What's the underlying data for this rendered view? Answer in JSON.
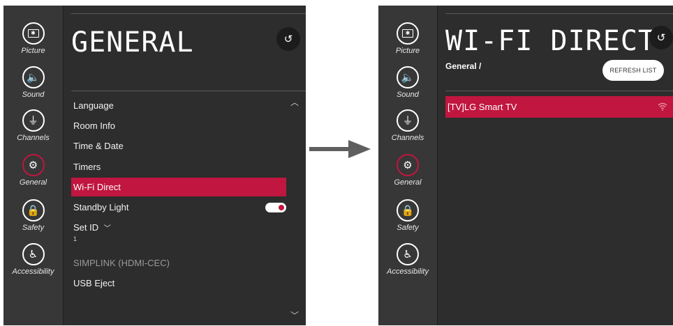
{
  "left_screen": {
    "title": "GENERAL",
    "back_icon": "back-arrow-icon",
    "categories": [
      {
        "label": "Picture",
        "icon": "tv-picture-icon"
      },
      {
        "label": "Sound",
        "icon": "speaker-icon"
      },
      {
        "label": "Channels",
        "icon": "satellite-dish-icon"
      },
      {
        "label": "General",
        "icon": "tools-gear-icon",
        "active": true
      },
      {
        "label": "Safety",
        "icon": "lock-icon"
      },
      {
        "label": "Accessibility",
        "icon": "accessibility-icon"
      }
    ],
    "menu": [
      {
        "label": "Language"
      },
      {
        "label": "Room Info"
      },
      {
        "label": "Time & Date"
      },
      {
        "label": "Timers"
      },
      {
        "label": "Wi-Fi Direct",
        "selected": true
      },
      {
        "label": "Standby Light",
        "toggle_on": true
      },
      {
        "label": "Set ID",
        "value": "1"
      },
      {
        "label": "SIMPLINK (HDMI-CEC)",
        "disabled": true
      },
      {
        "label": "USB Eject"
      }
    ]
  },
  "right_screen": {
    "title": "WI-FI DIRECT",
    "breadcrumb": "General /",
    "refresh_label": "REFRESH LIST",
    "back_icon": "back-arrow-icon",
    "categories": [
      {
        "label": "Picture"
      },
      {
        "label": "Sound"
      },
      {
        "label": "Channels"
      },
      {
        "label": "General",
        "active": true
      },
      {
        "label": "Safety"
      },
      {
        "label": "Accessibility"
      }
    ],
    "devices": [
      {
        "name": "[TV]LG Smart TV",
        "icon": "wifi-signal-icon"
      }
    ]
  },
  "colors": {
    "accent": "#c0163f",
    "panel": "#2d2d2d",
    "rail": "#373737",
    "arrow": "#5f5f5f"
  }
}
